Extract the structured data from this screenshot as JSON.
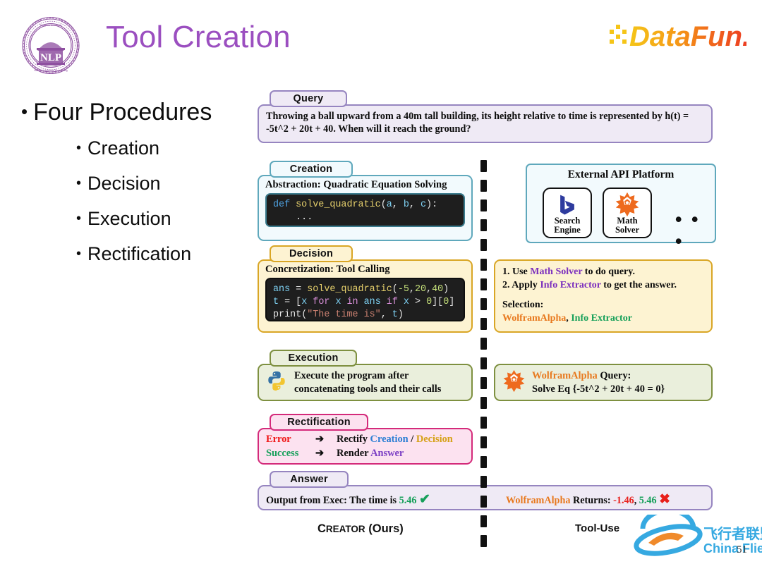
{
  "header": {
    "title": "Tool Creation",
    "logo_left_name": "thu-nlp-seal-logo",
    "logo_left_text": "NLP",
    "logo_right_text": "DataFun."
  },
  "bullets": {
    "main": "Four Procedures",
    "sub": [
      "Creation",
      "Decision",
      "Execution",
      "Rectification"
    ]
  },
  "diagram": {
    "query": {
      "tab": "Query",
      "text": "Throwing a ball upward from a 40m tall building, its height relative to time is represented by h(t) = -5t^2 + 20t + 40. When will it reach the ground?"
    },
    "creation": {
      "tab": "Creation",
      "heading": "Abstraction: Quadratic Equation Solving",
      "code_line1_kw": "def",
      "code_line1_fn": " solve_quadratic",
      "code_line1_p1": "(",
      "code_line1_a": "a",
      "code_line1_c1": ", ",
      "code_line1_b": "b",
      "code_line1_c2": ", ",
      "code_line1_cc": "c",
      "code_line1_p2": "):",
      "code_line2": "    ..."
    },
    "api_platform": {
      "title": "External API Platform",
      "cards": [
        {
          "icon": "bing-search-icon",
          "label_line1": "Search",
          "label_line2": "Engine"
        },
        {
          "icon": "wolfram-alpha-icon",
          "label_line1": "Math",
          "label_line2": "Solver"
        }
      ],
      "ellipsis": "• • •"
    },
    "decision": {
      "tab": "Decision",
      "heading": "Concretization: Tool Calling",
      "code": {
        "l1_var": "ans",
        "l1_eq": " = ",
        "l1_fn": "solve_quadratic",
        "l1_p1": "(",
        "l1_n1": "-5",
        "l1_c1": ",",
        "l1_n2": "20",
        "l1_c2": ",",
        "l1_n3": "40",
        "l1_p2": ")",
        "l2_t": "t",
        "l2_eq": " = [",
        "l2_x": "x",
        "l2_for": " for ",
        "l2_x2": "x",
        "l2_in": " in ",
        "l2_ans": "ans",
        "l2_if": " if ",
        "l2_x3": "x",
        "l2_gt": " > ",
        "l2_z": "0",
        "l2_tail": "][",
        "l2_z2": "0",
        "l2_tail2": "]",
        "l3_fn": "print",
        "l3_p1": "(",
        "l3_str": "\"The time is\"",
        "l3_c": ", ",
        "l3_t": "t",
        "l3_p2": ")"
      },
      "right": {
        "line1_a": "1. Use ",
        "line1_tool": "Math Solver",
        "line1_b": " to do query.",
        "line2_a": "2. Apply ",
        "line2_tool": "Info Extractor",
        "line2_b": " to get the answer.",
        "selection_label": "Selection:",
        "selection_tool1": "WolframAlpha",
        "selection_sep": ", ",
        "selection_tool2": "Info Extractor"
      }
    },
    "execution": {
      "tab": "Execution",
      "left_icon": "python-logo-icon",
      "left_line1": "Execute the program after",
      "left_line2": "concatenating tools and their calls",
      "right_icon": "wolfram-alpha-icon",
      "right_tool": "WolframAlpha",
      "right_label": " Query:",
      "right_line2": "Solve Eq {-5t^2 + 20t + 40 = 0}"
    },
    "rectification": {
      "tab": "Rectification",
      "row1_cond": "Error",
      "row1_arrow": "➔",
      "row1_act": "Rectify ",
      "row1_t1": "Creation",
      "row1_sep": " / ",
      "row1_t2": "Decision",
      "row2_cond": "Success",
      "row2_arrow": "➔",
      "row2_act": "Render ",
      "row2_t1": "Answer"
    },
    "answer": {
      "tab": "Answer",
      "left_text": "Output from Exec: The time is ",
      "left_value": "5.46",
      "left_mark": "✔",
      "right_tool": "WolframAlpha",
      "right_text": " Returns: ",
      "right_value_bad": "-1.46",
      "right_sep": ", ",
      "right_value_good": "5.46",
      "right_mark": "✖"
    },
    "captions": {
      "left_c": "C",
      "left_rest": "REATOR",
      "left_ours": " (Ours)",
      "right": "Tool-Use"
    }
  },
  "watermark": {
    "cn": "飞行者联盟",
    "en": "China Flier",
    "page_number": "51"
  },
  "colors": {
    "title_purple": "#9B4FC0",
    "query_border": "#9685C0",
    "creation_border": "#5FA8BC",
    "decision_border": "#D9A625",
    "execution_border": "#7E9040",
    "rectification_border": "#D42A7A",
    "wolfram_orange": "#E8791E",
    "success_green": "#16A05A",
    "error_red": "#E8201B"
  }
}
